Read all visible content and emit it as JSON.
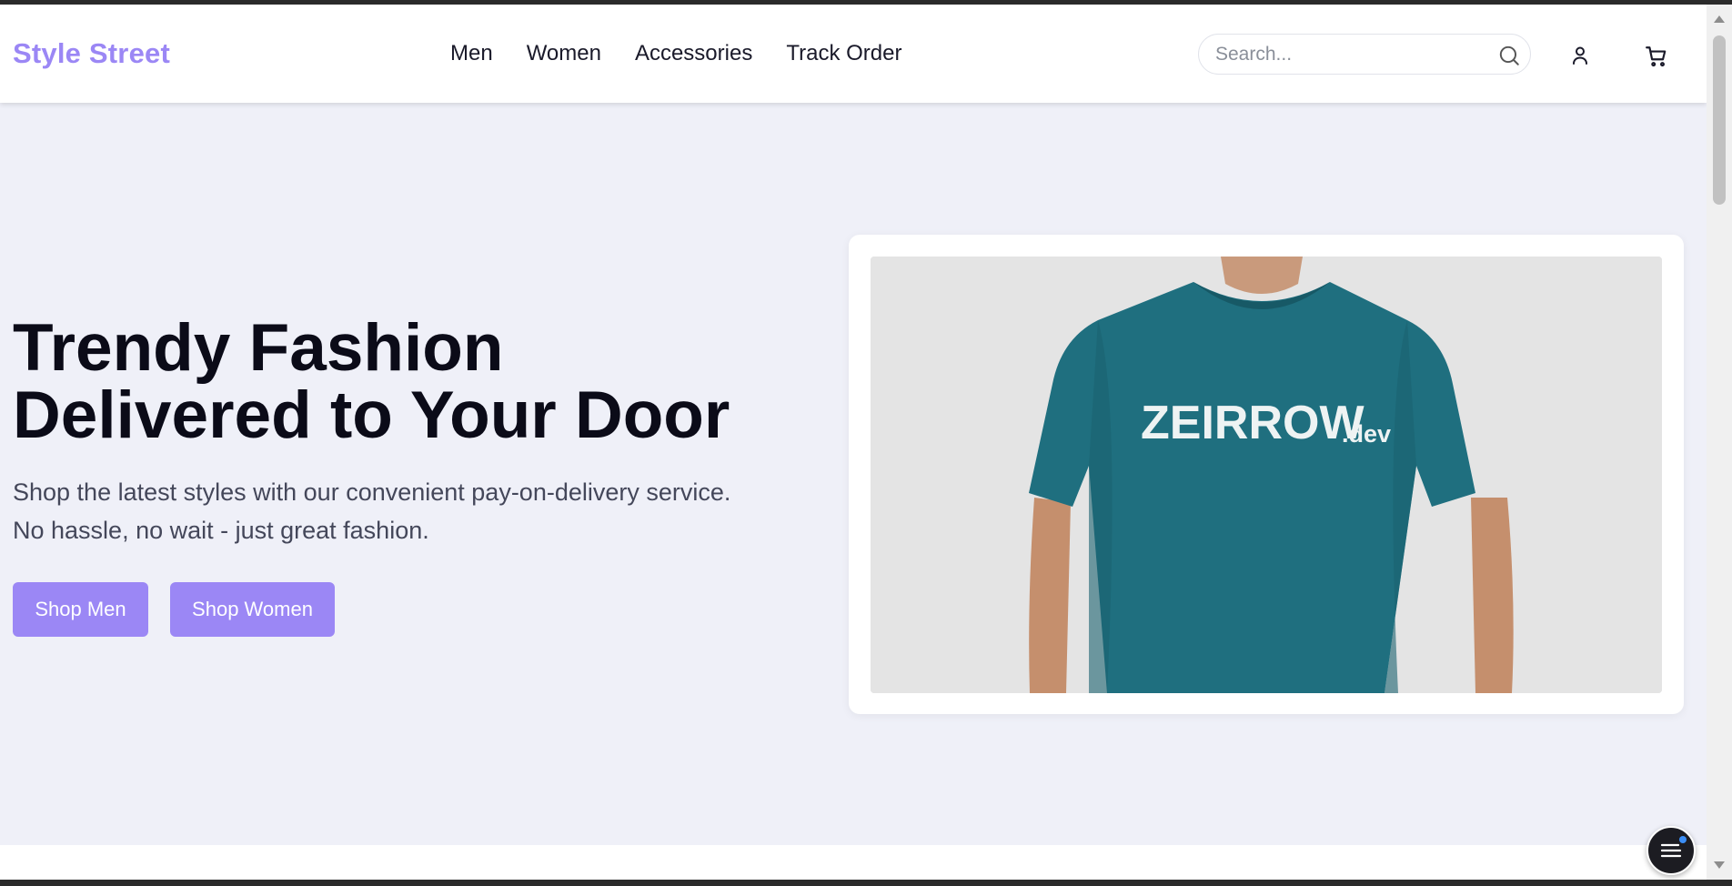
{
  "header": {
    "logo": "Style Street",
    "nav": [
      "Men",
      "Women",
      "Accessories",
      "Track Order"
    ],
    "search_placeholder": "Search..."
  },
  "hero": {
    "title_line1": "Trendy Fashion",
    "title_line2": "Delivered to Your Door",
    "subtitle_line1": "Shop the latest styles with our convenient pay-on-delivery service.",
    "subtitle_line2": "No hassle, no wait - just great fashion.",
    "buttons": [
      "Shop Men",
      "Shop Women"
    ],
    "image": {
      "shirt_text": "ZEIRROW",
      "shirt_suffix": ".dev"
    }
  },
  "icons": [
    "search-icon",
    "user-icon",
    "cart-icon",
    "menu-icon"
  ],
  "colors": {
    "brand": "#9b87f5",
    "hero_bg": "#eff0f8",
    "shirt": "#1f6f7f"
  }
}
